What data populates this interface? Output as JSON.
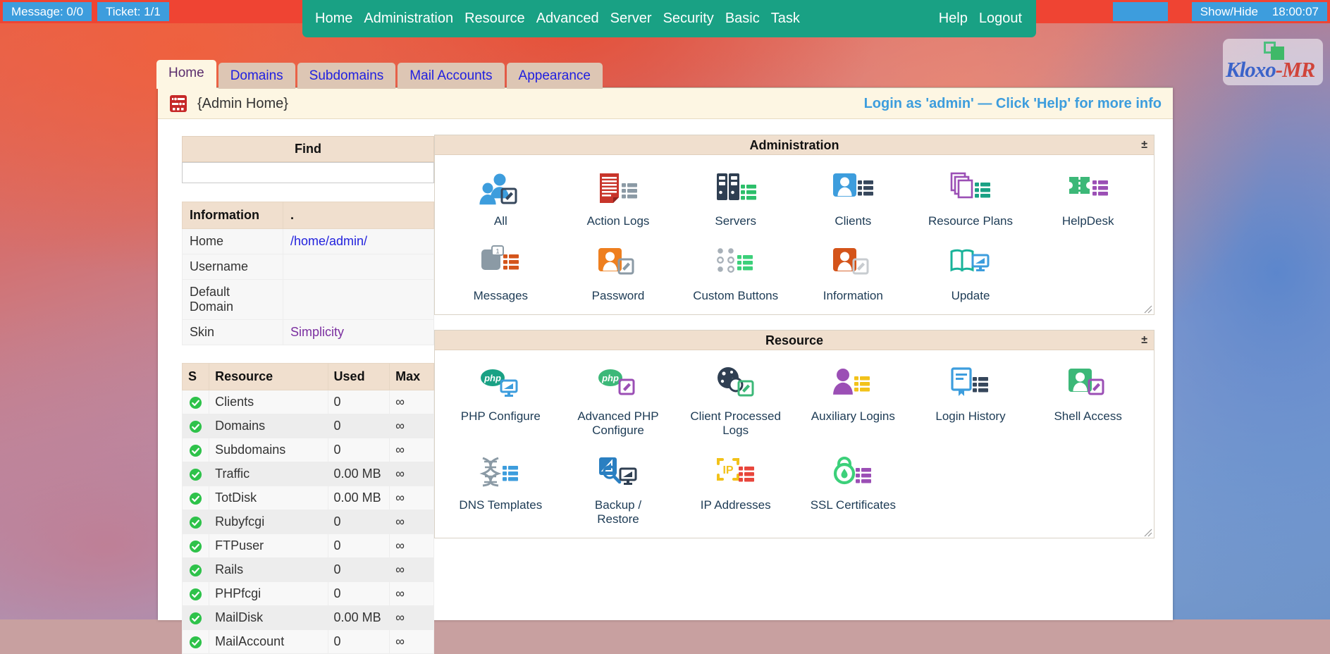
{
  "topbar": {
    "message_chip": "Message: 0/0",
    "ticket_chip": "Ticket: 1/1",
    "blank_chip": "",
    "showhide": "Show/Hide",
    "clock": "18:00:07",
    "bar_color": "#ef4433",
    "chip_color": "#3d9ddd"
  },
  "menubar": {
    "color": "#19a184",
    "left_items": [
      {
        "label": "Home"
      },
      {
        "label": "Administration"
      },
      {
        "label": "Resource"
      },
      {
        "label": "Advanced"
      },
      {
        "label": "Server"
      },
      {
        "label": "Security"
      },
      {
        "label": "Basic"
      },
      {
        "label": "Task"
      }
    ],
    "right_items": [
      {
        "label": "Help"
      },
      {
        "label": "Logout"
      }
    ]
  },
  "logo": {
    "part1": "Klo",
    "part2": "xo",
    "part3": "-MR",
    "full": "Kloxo-MR"
  },
  "tabs": [
    {
      "label": "Home",
      "active": true
    },
    {
      "label": "Domains",
      "active": false
    },
    {
      "label": "Subdomains",
      "active": false
    },
    {
      "label": "Mail Accounts",
      "active": false
    },
    {
      "label": "Appearance",
      "active": false
    }
  ],
  "titlebar": {
    "icon": "sliders-icon",
    "title": "{Admin Home}",
    "note": "Login as 'admin' — Click 'Help' for more info",
    "note_color": "#3d9ddd"
  },
  "find": {
    "header": "Find",
    "value": "",
    "placeholder": ""
  },
  "information": {
    "header_key": "Information",
    "header_value": ".",
    "rows": [
      {
        "key": "Home",
        "value": "/home/admin/",
        "link": "blue"
      },
      {
        "key": "Username",
        "value": "",
        "link": ""
      },
      {
        "key": "Default Domain",
        "value": "",
        "link": ""
      },
      {
        "key": "Skin",
        "value": "Simplicity",
        "link": "purple"
      }
    ]
  },
  "resource_table": {
    "headers": [
      "S",
      "Resource",
      "Used",
      "Max"
    ],
    "rows": [
      {
        "status": "ok",
        "resource": "Clients",
        "used": "0",
        "max": "∞"
      },
      {
        "status": "ok",
        "resource": "Domains",
        "used": "0",
        "max": "∞"
      },
      {
        "status": "ok",
        "resource": "Subdomains",
        "used": "0",
        "max": "∞"
      },
      {
        "status": "ok",
        "resource": "Traffic",
        "used": "0.00 MB",
        "max": "∞"
      },
      {
        "status": "ok",
        "resource": "TotDisk",
        "used": "0.00 MB",
        "max": "∞"
      },
      {
        "status": "ok",
        "resource": "Rubyfcgi",
        "used": "0",
        "max": "∞"
      },
      {
        "status": "ok",
        "resource": "FTPuser",
        "used": "0",
        "max": "∞"
      },
      {
        "status": "ok",
        "resource": "Rails",
        "used": "0",
        "max": "∞"
      },
      {
        "status": "ok",
        "resource": "PHPfcgi",
        "used": "0",
        "max": "∞"
      },
      {
        "status": "ok",
        "resource": "MailDisk",
        "used": "0.00 MB",
        "max": "∞"
      },
      {
        "status": "ok",
        "resource": "MailAccount",
        "used": "0",
        "max": "∞"
      }
    ]
  },
  "panels": [
    {
      "title": "Administration",
      "toggle": "±",
      "items": [
        {
          "label": "All",
          "icon": "users-edit-icon"
        },
        {
          "label": "Action Logs",
          "icon": "document-list-icon"
        },
        {
          "label": "Servers",
          "icon": "servers-icon"
        },
        {
          "label": "Clients",
          "icon": "client-user-icon"
        },
        {
          "label": "Resource Plans",
          "icon": "stacked-pages-icon"
        },
        {
          "label": "HelpDesk",
          "icon": "ticket-icon"
        },
        {
          "label": "Messages",
          "icon": "message-badge-icon"
        },
        {
          "label": "Password",
          "icon": "user-edit-orange-icon"
        },
        {
          "label": "Custom Buttons",
          "icon": "dots-grid-icon"
        },
        {
          "label": "Information",
          "icon": "user-info-icon"
        },
        {
          "label": "Update",
          "icon": "book-monitor-icon"
        }
      ]
    },
    {
      "title": "Resource",
      "toggle": "±",
      "items": [
        {
          "label": "PHP Configure",
          "icon": "php-monitor-icon"
        },
        {
          "label": "Advanced PHP Configure",
          "icon": "php-edit-icon"
        },
        {
          "label": "Client Processed Logs",
          "icon": "globe-edit-icon"
        },
        {
          "label": "Auxiliary Logins",
          "icon": "user-list-purple-icon"
        },
        {
          "label": "Login History",
          "icon": "book-list-icon"
        },
        {
          "label": "Shell Access",
          "icon": "user-edit-green-icon"
        },
        {
          "label": "DNS Templates",
          "icon": "dna-list-icon"
        },
        {
          "label": "Backup / Restore",
          "icon": "backup-monitor-icon"
        },
        {
          "label": "IP Addresses",
          "icon": "ip-list-icon"
        },
        {
          "label": "SSL Certificates",
          "icon": "lock-list-icon"
        }
      ]
    }
  ]
}
